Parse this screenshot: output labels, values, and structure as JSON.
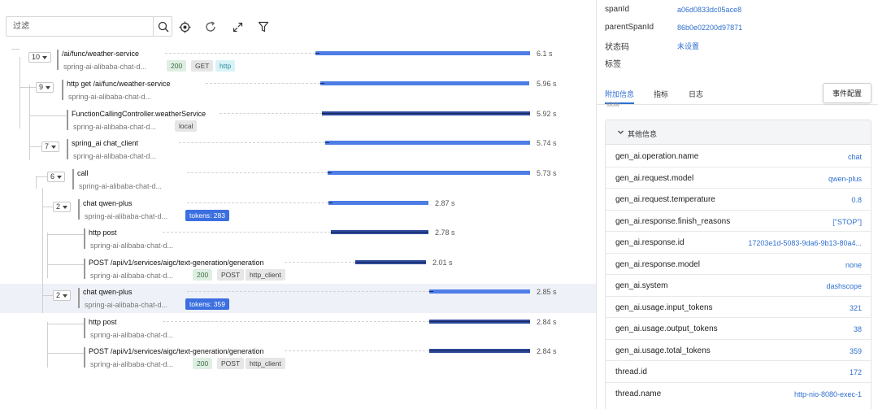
{
  "filter": {
    "placeholder": "过滤"
  },
  "spans": [
    {
      "toggle": "10",
      "name": "/ai/func/weather-service",
      "service": "spring-ai-alibaba-chat-d...",
      "tags": [
        {
          "text": "200",
          "style": "ok"
        },
        {
          "text": "GET",
          "style": "grey"
        },
        {
          "text": "http",
          "style": "cyan"
        }
      ],
      "duration": "6.1 s"
    },
    {
      "toggle": "9",
      "name": "http get /ai/func/weather-service",
      "service": "spring-ai-alibaba-chat-d...",
      "tags": [],
      "duration": "5.96 s"
    },
    {
      "toggle": "",
      "name": "FunctionCallingController.weatherService",
      "service": "spring-ai-alibaba-chat-d...",
      "tags": [
        {
          "text": "local",
          "style": "grey"
        }
      ],
      "duration": "5.92 s"
    },
    {
      "toggle": "7",
      "name": "spring_ai chat_client",
      "service": "spring-ai-alibaba-chat-d...",
      "tags": [],
      "duration": "5.74 s"
    },
    {
      "toggle": "6",
      "name": "call",
      "service": "spring-ai-alibaba-chat-d...",
      "tags": [],
      "duration": "5.73 s"
    },
    {
      "toggle": "2",
      "name": "chat qwen-plus",
      "service": "spring-ai-alibaba-chat-d...",
      "tags": [
        {
          "text": "tokens: 283",
          "style": "blue"
        }
      ],
      "duration": "2.87 s"
    },
    {
      "toggle": "",
      "name": "http post",
      "service": "spring-ai-alibaba-chat-d...",
      "tags": [],
      "duration": "2.78 s"
    },
    {
      "toggle": "",
      "name": "POST /api/v1/services/aigc/text-generation/generation",
      "service": "spring-ai-alibaba-chat-d...",
      "tags": [
        {
          "text": "200",
          "style": "ok"
        },
        {
          "text": "POST",
          "style": "grey"
        },
        {
          "text": "http_client",
          "style": "grey"
        }
      ],
      "duration": "2.01 s"
    },
    {
      "toggle": "2",
      "name": "chat qwen-plus",
      "service": "spring-ai-alibaba-chat-d...",
      "tags": [
        {
          "text": "tokens: 359",
          "style": "blue"
        }
      ],
      "duration": "2.85 s"
    },
    {
      "toggle": "",
      "name": "http post",
      "service": "spring-ai-alibaba-chat-d...",
      "tags": [],
      "duration": "2.84 s"
    },
    {
      "toggle": "",
      "name": "POST /api/v1/services/aigc/text-generation/generation",
      "service": "spring-ai-alibaba-chat-d...",
      "tags": [
        {
          "text": "200",
          "style": "ok"
        },
        {
          "text": "POST",
          "style": "grey"
        },
        {
          "text": "http_client",
          "style": "grey"
        }
      ],
      "duration": "2.84 s"
    }
  ],
  "details": {
    "span_id_label": "spanId",
    "span_id": "a06d0833dc05ace8",
    "parent_span_id_label": "parentSpanId",
    "parent_span_id": "86b0e02200d97871",
    "status_label": "状态码",
    "status": "未设置",
    "tags_label": "标签"
  },
  "tabs": [
    "附加信息",
    "指标",
    "日志"
  ],
  "event_button": "事件配置",
  "slow_peek": "slow",
  "info_title": "其他信息",
  "info_rows": [
    {
      "key": "gen_ai.operation.name",
      "value": "chat"
    },
    {
      "key": "gen_ai.request.model",
      "value": "qwen-plus"
    },
    {
      "key": "gen_ai.request.temperature",
      "value": "0.8"
    },
    {
      "key": "gen_ai.response.finish_reasons",
      "value": "[\"STOP\"]"
    },
    {
      "key": "gen_ai.response.id",
      "value": "17203e1d-5083-9da6-9b13-80a4..."
    },
    {
      "key": "gen_ai.response.model",
      "value": "none"
    },
    {
      "key": "gen_ai.system",
      "value": "dashscope"
    },
    {
      "key": "gen_ai.usage.input_tokens",
      "value": "321"
    },
    {
      "key": "gen_ai.usage.output_tokens",
      "value": "38"
    },
    {
      "key": "gen_ai.usage.total_tokens",
      "value": "359"
    },
    {
      "key": "thread.id",
      "value": "172"
    },
    {
      "key": "thread.name",
      "value": "http-nio-8080-exec-1"
    }
  ]
}
